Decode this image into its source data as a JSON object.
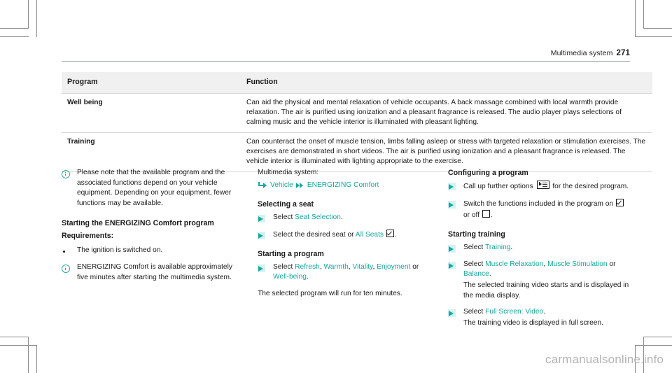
{
  "running_head": {
    "title": "Multimedia system",
    "page_number": "271"
  },
  "table": {
    "headers": [
      "Program",
      "Function"
    ],
    "rows": [
      {
        "program": "Well being",
        "function": "Can aid the physical and mental relaxation of vehicle occupants. A back massage combined with local warmth provide relaxation. The air is purified using ionization and a pleasant fragrance is released. The audio player plays selections of calming music and the vehicle interior is illuminated with pleasant lighting."
      },
      {
        "program": "Training",
        "function": "Can counteract the onset of muscle tension, limbs falling asleep or stress with targeted relaxation or stimulation exercises. The exercises are demonstrated in short videos. The air is purified using ionization and a pleasant fragrance is released. The vehicle interior is illuminated with lighting appropriate to the exercise."
      }
    ]
  },
  "left_column": {
    "note_1": "Please note that the available program and the associated functions depend on your vehicle equipment. Depending on your equipment, fewer functions may be available.",
    "heading_start": "Starting the ENERGIZING Comfort program",
    "subheading_requirements": "Requirements:",
    "bullet_1": "The ignition is switched on.",
    "note_2": "ENERGIZING Comfort is available approximately five minutes after starting the multimedia system."
  },
  "middle_column": {
    "system_label": "Multimedia system:",
    "menu_path": {
      "item_1": "Vehicle",
      "item_2": "ENERGIZING Comfort"
    },
    "heading_seat": "Selecting a seat",
    "step_1_pre": "Select ",
    "step_1_term": "Seat Selection",
    "step_1_post": ".",
    "step_2_pre": "Select the desired seat or ",
    "step_2_term": "All Seats",
    "step_2_post": ".",
    "heading_program": "Starting a program",
    "step_3_pre": "Select ",
    "step_3_terms": [
      "Refresh",
      "Warmth",
      "Vitality",
      "Enjoyment",
      "Well-being"
    ],
    "step_3_or": "or",
    "step_3_post": ".",
    "result_text": "The selected program will run for ten minutes."
  },
  "right_column": {
    "heading_configuring": "Configuring a program",
    "step_1_pre": "Call up further options ",
    "step_1_post": " for the desired program.",
    "step_2_pre": "Switch the functions included in the program on ",
    "step_2_mid": " or off ",
    "step_2_post": ".",
    "heading_training": "Starting training",
    "step_3_pre": "Select ",
    "step_3_term": "Training",
    "step_3_post": ".",
    "step_4_pre": "Select ",
    "step_4_terms": [
      "Muscle Relaxation",
      "Muscle Stimulation",
      "Balance"
    ],
    "step_4_or": "or",
    "step_4_post": ".",
    "step_4_result": "The selected training video starts and is displayed in the media display.",
    "step_5_pre": "Select ",
    "step_5_term": "Full Screen: Video",
    "step_5_post": ".",
    "step_5_result": "The training video is displayed in full screen."
  },
  "watermark": "carmanualsonline.info",
  "colors": {
    "accent_teal": "#16a59d",
    "step_pad": "#d6f2f0",
    "table_header_bg": "#f0f0f0",
    "rule": "#9aa8a6"
  }
}
